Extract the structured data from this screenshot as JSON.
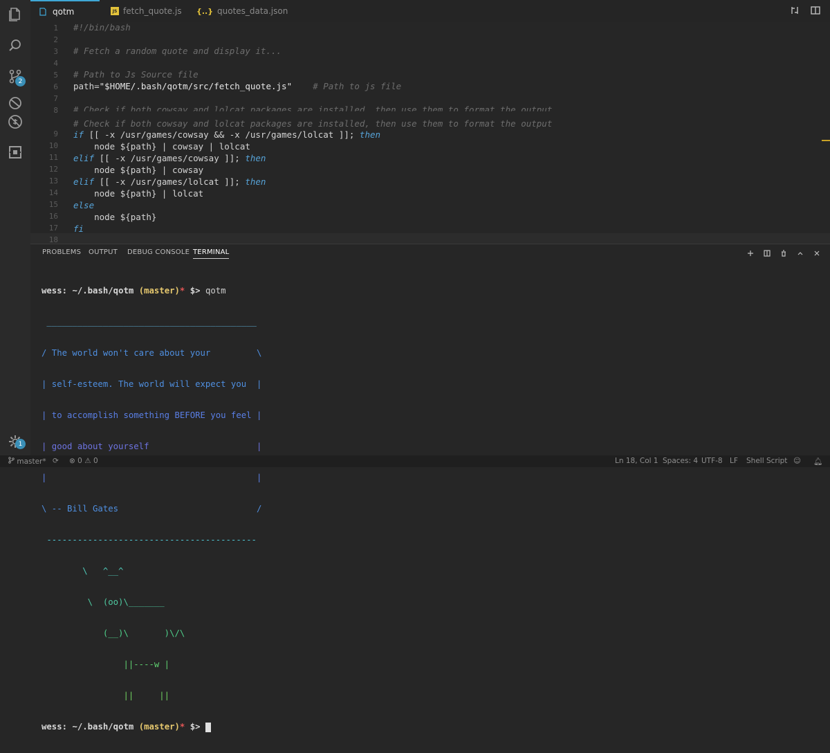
{
  "activity": {
    "scm_badge": "2",
    "settings_badge": "1"
  },
  "tabs": [
    {
      "label": "qotm",
      "active": true
    },
    {
      "label": "fetch_quote.js",
      "active": false
    },
    {
      "label": "quotes_data.json",
      "active": false
    }
  ],
  "tab_icons": {
    "js": "JS",
    "json": "{..}"
  },
  "editor": {
    "lines": [
      "1",
      "2",
      "3",
      "4",
      "5",
      "6",
      "7",
      "8",
      "9",
      "10",
      "11",
      "12",
      "13",
      "14",
      "15",
      "16",
      "17",
      "18"
    ],
    "code": {
      "l1": "#!/bin/bash",
      "l3": "# Fetch a random quote and display it...",
      "l5": "# Path to Js Source file",
      "l6a": "path=",
      "l6b": "\"$HOME/.bash/qotm/src/fetch_quote.js\"",
      "l6c": "# Path to js file",
      "l8": "# Check if both cowsay and lolcat packages are installed, then use them to format the output",
      "l9": "# Check if both cowsay and lolcat packages are installed, then use them to format the output",
      "l9b_kw1": "if",
      "l9b_mid": " [[ -x /usr/games/cowsay && -x /usr/games/lolcat ]]; ",
      "l9b_kw2": "then",
      "l10": "    node ${path} | cowsay | lolcat",
      "l11_kw1": "elif",
      "l11_mid": " [[ -x /usr/games/cowsay ]]; ",
      "l11_kw2": "then",
      "l12": "    node ${path} | cowsay",
      "l13_kw1": "elif",
      "l13_mid": " [[ -x /usr/games/lolcat ]]; ",
      "l13_kw2": "then",
      "l14": "    node ${path} | lolcat",
      "l15": "else",
      "l16": "    node ${path}",
      "l17": "fi"
    }
  },
  "panel": {
    "tabs": [
      "PROBLEMS",
      "OUTPUT",
      "DEBUG CONSOLE",
      "TERMINAL"
    ],
    "active_tab": "TERMINAL"
  },
  "terminal": {
    "prompt_user": "wess:",
    "prompt_path": "~/.bash/qotm",
    "prompt_branch": "(master)",
    "prompt_star": "*",
    "prompt_symbol": "$>",
    "command": "qotm",
    "cowsay_lines": [
      " _________________________________________",
      "/ The world won't care about your         \\",
      "| self-esteem. The world will expect you  |",
      "| to accomplish something BEFORE you feel |",
      "| good about yourself                     |",
      "|                                         |",
      "\\ -- Bill Gates                           /",
      " -----------------------------------------",
      "        \\   ^__^",
      "         \\  (oo)\\_______",
      "            (__)\\       )\\/\\",
      "                ||----w |",
      "                ||     ||"
    ]
  },
  "status": {
    "branch": "master*",
    "errors": "0",
    "warnings": "0",
    "position": "Ln 18, Col 1",
    "spaces": "Spaces: 4",
    "encoding": "UTF-8",
    "eol": "LF",
    "language": "Shell Script"
  },
  "colors": {
    "accent": "#3fa7d6",
    "quote_text": "#4f8fe0",
    "cow_border": "#4fc9a0"
  }
}
